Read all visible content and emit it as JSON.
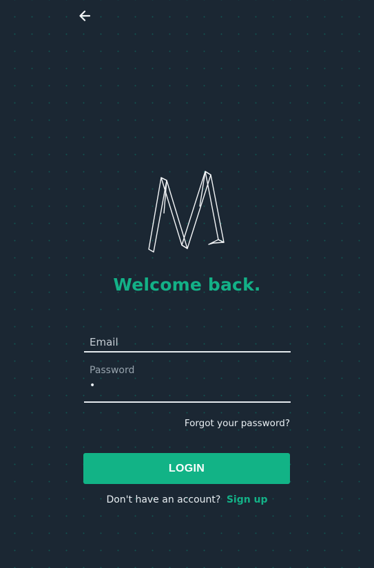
{
  "nav": {
    "back_icon": "arrow-left-icon"
  },
  "brand": {
    "logo_icon": "m-logo-icon",
    "welcome_text": "Welcome back."
  },
  "form": {
    "email_placeholder": "Email",
    "password_label": "Password",
    "password_masked": "•",
    "forgot_link": "Forgot your password?",
    "login_label": "LOGIN",
    "signup_prompt": "Don't have an account?",
    "signup_link": "Sign up"
  },
  "colors": {
    "background": "#1b2733",
    "accent": "#13b187",
    "text": "#e8eef2"
  }
}
